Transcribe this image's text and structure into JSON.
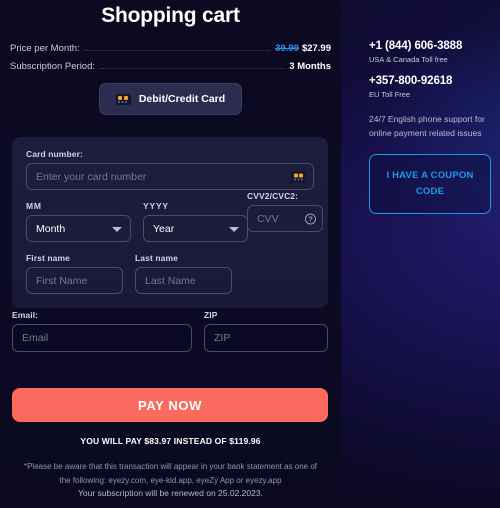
{
  "page": {
    "title": "Shopping cart"
  },
  "summary": {
    "rows": [
      {
        "label": "Price per Month:",
        "old_value": "39.99",
        "value": "$27.99"
      },
      {
        "label": "Subscription Period:",
        "old_value": "",
        "value": "3 Months"
      }
    ]
  },
  "payment_tabs": [
    {
      "label": "Debit/Credit Card",
      "icon": "credit-card-icon",
      "selected": true
    }
  ],
  "card_form": {
    "card_number": {
      "label": "Card number:",
      "placeholder": "Enter your card number",
      "value": "",
      "icon": "credit-card-icon"
    },
    "month": {
      "label": "MM",
      "placeholder": "Month",
      "value": "Month"
    },
    "year": {
      "label": "YYYY",
      "placeholder": "Year",
      "value": "Year"
    },
    "cvv": {
      "label": "CVV2/CVC2:",
      "placeholder": "CVV",
      "value": "",
      "help_icon": "question-mark-icon"
    },
    "first_name": {
      "label": "First name",
      "placeholder": "First Name",
      "value": ""
    },
    "last_name": {
      "label": "Last name",
      "placeholder": "Last Name",
      "value": ""
    }
  },
  "contact": {
    "email": {
      "label": "Email:",
      "placeholder": "Email",
      "value": ""
    },
    "zip": {
      "label": "ZIP",
      "placeholder": "ZIP",
      "value": ""
    }
  },
  "checkout": {
    "pay_button": "PAY NOW",
    "pay_note": "YOU WILL PAY $83.97 INSTEAD OF $119.96",
    "disclaimer": "*Please be aware that this transaction will appear in your bank statement as one of the following: eyezy.com, eye-kid.app, eyeZy App or eyezy.app",
    "renewal": "Your subscription will be renewed on 25.02.2023."
  },
  "sidebar": {
    "phone_us": "+1 (844) 606-3888",
    "phone_us_sub": "USA & Canada Toll free",
    "phone_eu": "+357-800-92618",
    "phone_eu_sub": "EU Toll Free",
    "support_note": "24/7 English phone support for online payment related issues",
    "coupon_button": "I HAVE A COUPON CODE"
  },
  "colors": {
    "accent_pay": "#fb6a5e",
    "accent_link": "#1e9ae8",
    "old_price": "#2f8fe0",
    "page_bg": "#0b0a20",
    "panel_bg": "#1c1c3c"
  }
}
